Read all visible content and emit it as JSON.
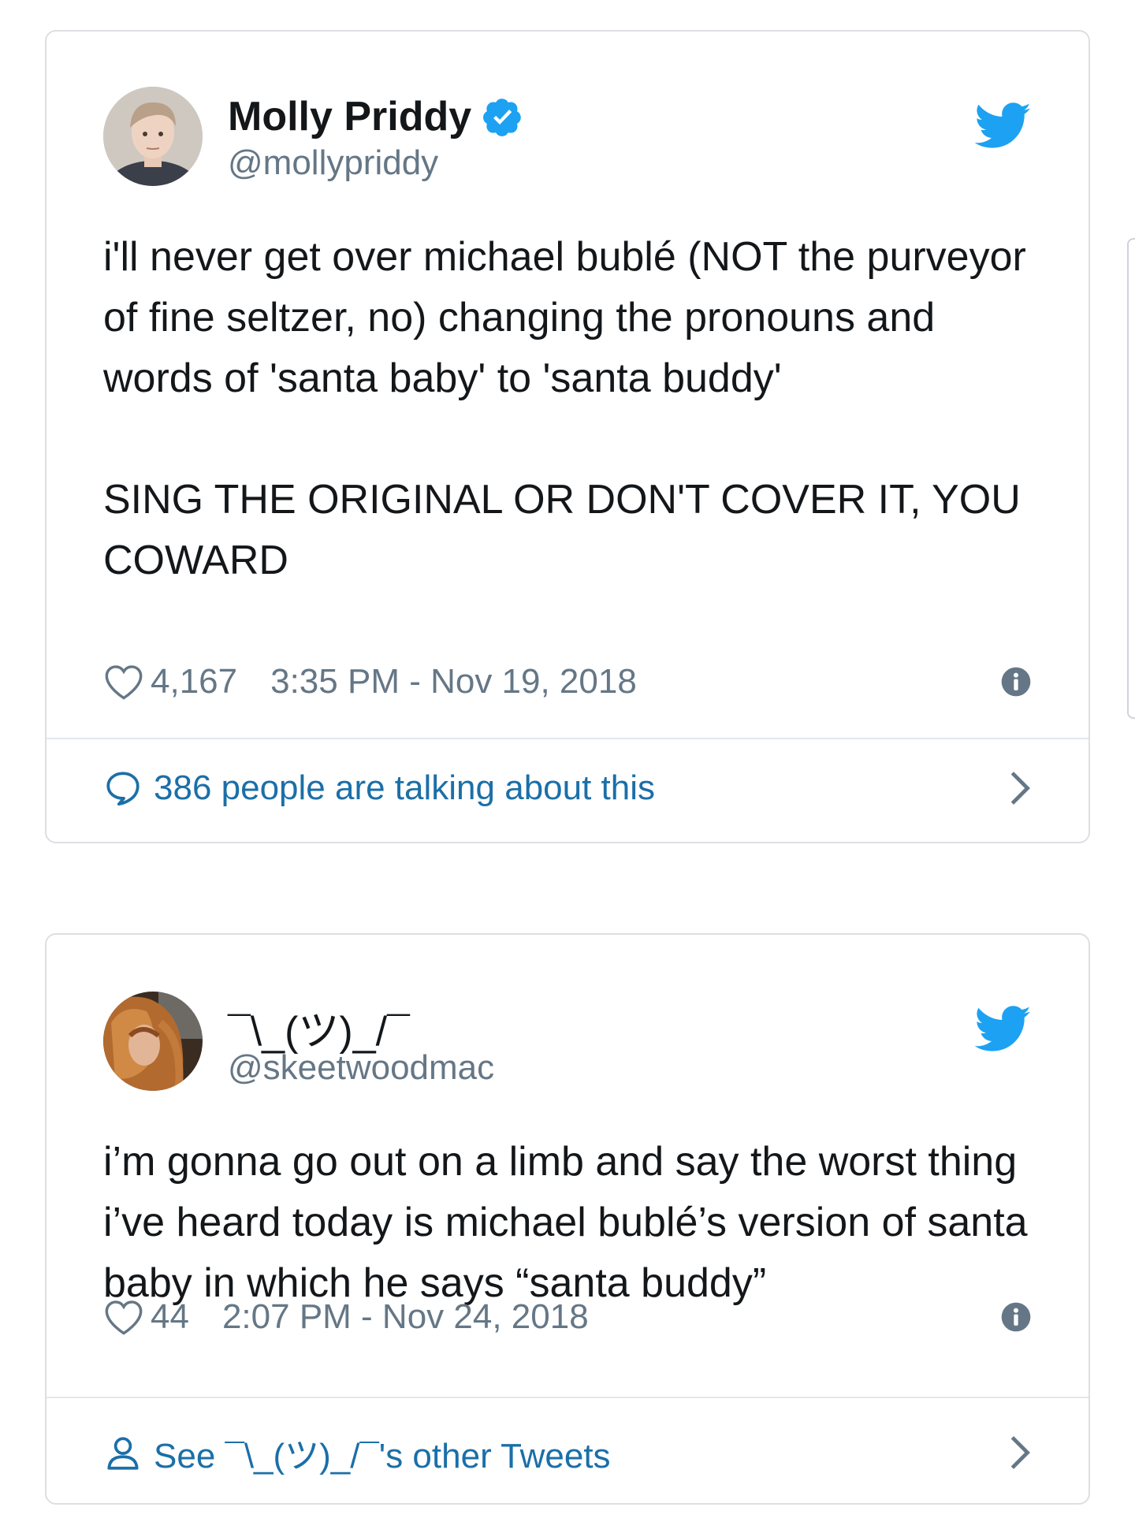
{
  "tweets": [
    {
      "name": "Molly Priddy",
      "verified": true,
      "handle": "@mollypriddy",
      "text_paragraph_1": "i'll never get over michael bublé (NOT the purveyor of fine seltzer, no) changing the pronouns and words of 'santa baby' to 'santa buddy'",
      "text_paragraph_2": "SING THE ORIGINAL OR DON'T COVER IT, YOU COWARD",
      "likes": "4,167",
      "timestamp": "3:35 PM - Nov 19, 2018",
      "footer_label": "386 people are talking about this",
      "footer_icon": "speech-bubble-icon"
    },
    {
      "name": "¯\\_(ツ)_/¯",
      "verified": false,
      "handle": "@skeetwoodmac",
      "text_paragraph_1": "i’m gonna go out on a limb and say the worst thing i’ve heard today is michael bublé’s version of santa baby in which he says “santa buddy”",
      "likes": "44",
      "timestamp": "2:07 PM - Nov 24, 2018",
      "footer_label": "See ¯\\_(ツ)_/¯'s other Tweets",
      "footer_icon": "person-icon"
    }
  ],
  "colors": {
    "twitter_blue": "#1da1f2",
    "link_blue": "#1b6fa8",
    "text": "#14171a",
    "secondary": "#657786",
    "border": "#dcdfe3"
  }
}
